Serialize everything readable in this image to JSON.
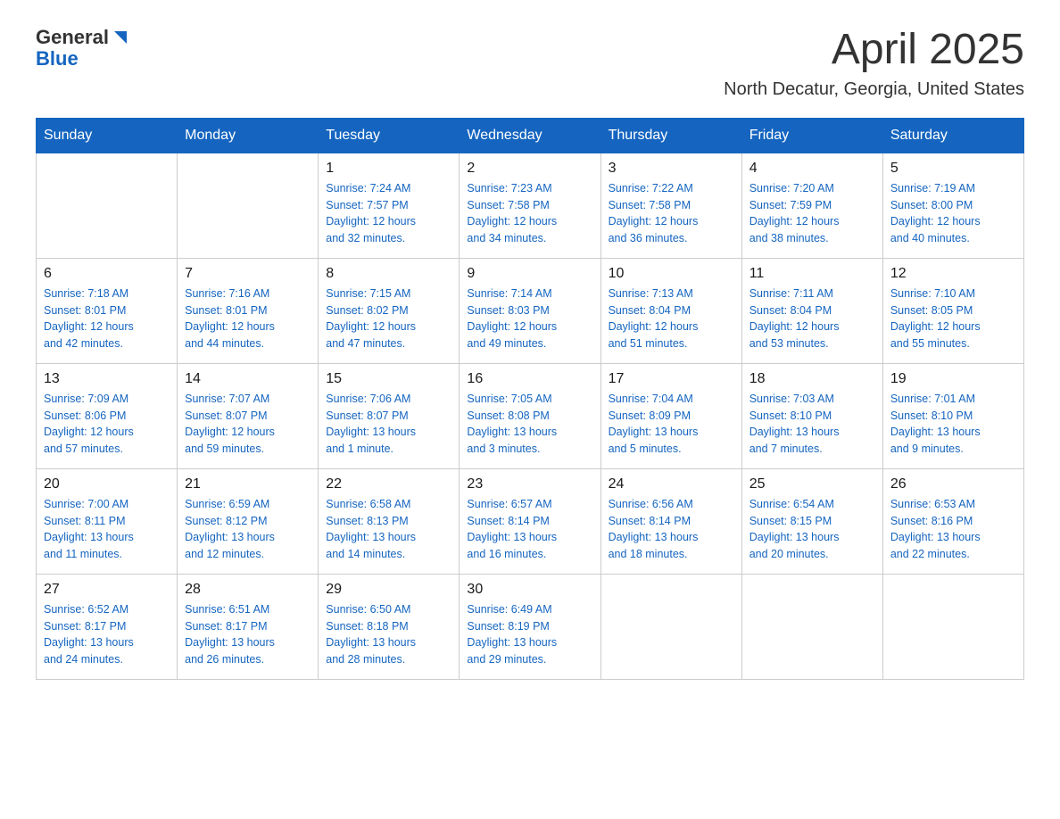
{
  "header": {
    "logo_general": "General",
    "logo_blue": "Blue",
    "month_title": "April 2025",
    "location": "North Decatur, Georgia, United States"
  },
  "weekdays": [
    "Sunday",
    "Monday",
    "Tuesday",
    "Wednesday",
    "Thursday",
    "Friday",
    "Saturday"
  ],
  "weeks": [
    [
      {
        "day": "",
        "info": ""
      },
      {
        "day": "",
        "info": ""
      },
      {
        "day": "1",
        "info": "Sunrise: 7:24 AM\nSunset: 7:57 PM\nDaylight: 12 hours\nand 32 minutes."
      },
      {
        "day": "2",
        "info": "Sunrise: 7:23 AM\nSunset: 7:58 PM\nDaylight: 12 hours\nand 34 minutes."
      },
      {
        "day": "3",
        "info": "Sunrise: 7:22 AM\nSunset: 7:58 PM\nDaylight: 12 hours\nand 36 minutes."
      },
      {
        "day": "4",
        "info": "Sunrise: 7:20 AM\nSunset: 7:59 PM\nDaylight: 12 hours\nand 38 minutes."
      },
      {
        "day": "5",
        "info": "Sunrise: 7:19 AM\nSunset: 8:00 PM\nDaylight: 12 hours\nand 40 minutes."
      }
    ],
    [
      {
        "day": "6",
        "info": "Sunrise: 7:18 AM\nSunset: 8:01 PM\nDaylight: 12 hours\nand 42 minutes."
      },
      {
        "day": "7",
        "info": "Sunrise: 7:16 AM\nSunset: 8:01 PM\nDaylight: 12 hours\nand 44 minutes."
      },
      {
        "day": "8",
        "info": "Sunrise: 7:15 AM\nSunset: 8:02 PM\nDaylight: 12 hours\nand 47 minutes."
      },
      {
        "day": "9",
        "info": "Sunrise: 7:14 AM\nSunset: 8:03 PM\nDaylight: 12 hours\nand 49 minutes."
      },
      {
        "day": "10",
        "info": "Sunrise: 7:13 AM\nSunset: 8:04 PM\nDaylight: 12 hours\nand 51 minutes."
      },
      {
        "day": "11",
        "info": "Sunrise: 7:11 AM\nSunset: 8:04 PM\nDaylight: 12 hours\nand 53 minutes."
      },
      {
        "day": "12",
        "info": "Sunrise: 7:10 AM\nSunset: 8:05 PM\nDaylight: 12 hours\nand 55 minutes."
      }
    ],
    [
      {
        "day": "13",
        "info": "Sunrise: 7:09 AM\nSunset: 8:06 PM\nDaylight: 12 hours\nand 57 minutes."
      },
      {
        "day": "14",
        "info": "Sunrise: 7:07 AM\nSunset: 8:07 PM\nDaylight: 12 hours\nand 59 minutes."
      },
      {
        "day": "15",
        "info": "Sunrise: 7:06 AM\nSunset: 8:07 PM\nDaylight: 13 hours\nand 1 minute."
      },
      {
        "day": "16",
        "info": "Sunrise: 7:05 AM\nSunset: 8:08 PM\nDaylight: 13 hours\nand 3 minutes."
      },
      {
        "day": "17",
        "info": "Sunrise: 7:04 AM\nSunset: 8:09 PM\nDaylight: 13 hours\nand 5 minutes."
      },
      {
        "day": "18",
        "info": "Sunrise: 7:03 AM\nSunset: 8:10 PM\nDaylight: 13 hours\nand 7 minutes."
      },
      {
        "day": "19",
        "info": "Sunrise: 7:01 AM\nSunset: 8:10 PM\nDaylight: 13 hours\nand 9 minutes."
      }
    ],
    [
      {
        "day": "20",
        "info": "Sunrise: 7:00 AM\nSunset: 8:11 PM\nDaylight: 13 hours\nand 11 minutes."
      },
      {
        "day": "21",
        "info": "Sunrise: 6:59 AM\nSunset: 8:12 PM\nDaylight: 13 hours\nand 12 minutes."
      },
      {
        "day": "22",
        "info": "Sunrise: 6:58 AM\nSunset: 8:13 PM\nDaylight: 13 hours\nand 14 minutes."
      },
      {
        "day": "23",
        "info": "Sunrise: 6:57 AM\nSunset: 8:14 PM\nDaylight: 13 hours\nand 16 minutes."
      },
      {
        "day": "24",
        "info": "Sunrise: 6:56 AM\nSunset: 8:14 PM\nDaylight: 13 hours\nand 18 minutes."
      },
      {
        "day": "25",
        "info": "Sunrise: 6:54 AM\nSunset: 8:15 PM\nDaylight: 13 hours\nand 20 minutes."
      },
      {
        "day": "26",
        "info": "Sunrise: 6:53 AM\nSunset: 8:16 PM\nDaylight: 13 hours\nand 22 minutes."
      }
    ],
    [
      {
        "day": "27",
        "info": "Sunrise: 6:52 AM\nSunset: 8:17 PM\nDaylight: 13 hours\nand 24 minutes."
      },
      {
        "day": "28",
        "info": "Sunrise: 6:51 AM\nSunset: 8:17 PM\nDaylight: 13 hours\nand 26 minutes."
      },
      {
        "day": "29",
        "info": "Sunrise: 6:50 AM\nSunset: 8:18 PM\nDaylight: 13 hours\nand 28 minutes."
      },
      {
        "day": "30",
        "info": "Sunrise: 6:49 AM\nSunset: 8:19 PM\nDaylight: 13 hours\nand 29 minutes."
      },
      {
        "day": "",
        "info": ""
      },
      {
        "day": "",
        "info": ""
      },
      {
        "day": "",
        "info": ""
      }
    ]
  ]
}
